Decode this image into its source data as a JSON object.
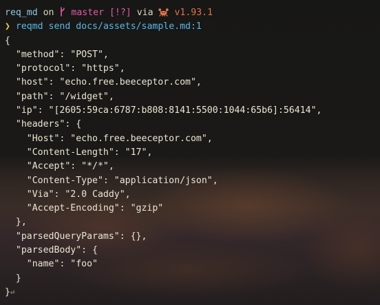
{
  "prompt": {
    "directory": "req_md",
    "on_label": "on",
    "branch_icon": "git-branch-icon",
    "branch": "master",
    "git_status": "[!?]",
    "via_label": "via",
    "lang_icon": "rust-crab-icon",
    "version": "v1.93.1",
    "symbol": "❯",
    "command": "reqmd send docs/assets/sample.md:1"
  },
  "output": [
    "{",
    "  \"method\": \"POST\",",
    "  \"protocol\": \"https\",",
    "  \"host\": \"echo.free.beeceptor.com\",",
    "  \"path\": \"/widget\",",
    "  \"ip\": \"[2605:59ca:6787:b808:8141:5500:1044:65b6]:56414\",",
    "  \"headers\": {",
    "    \"Host\": \"echo.free.beeceptor.com\",",
    "    \"Content-Length\": \"17\",",
    "    \"Accept\": \"*/*\",",
    "    \"Content-Type\": \"application/json\",",
    "    \"Via\": \"2.0 Caddy\",",
    "    \"Accept-Encoding\": \"gzip\"",
    "  },",
    "  \"parsedQueryParams\": {},",
    "  \"parsedBody\": {",
    "    \"name\": \"foo\"",
    "  }",
    "}"
  ],
  "no_newline_marker": "⏎",
  "colors": {
    "directory": "#8cc7e6",
    "branch": "#e35aa8",
    "version": "#e0734b",
    "prompt_symbol": "#e3cf5a",
    "command": "#58b8e8",
    "text": "#ebe6d2"
  }
}
